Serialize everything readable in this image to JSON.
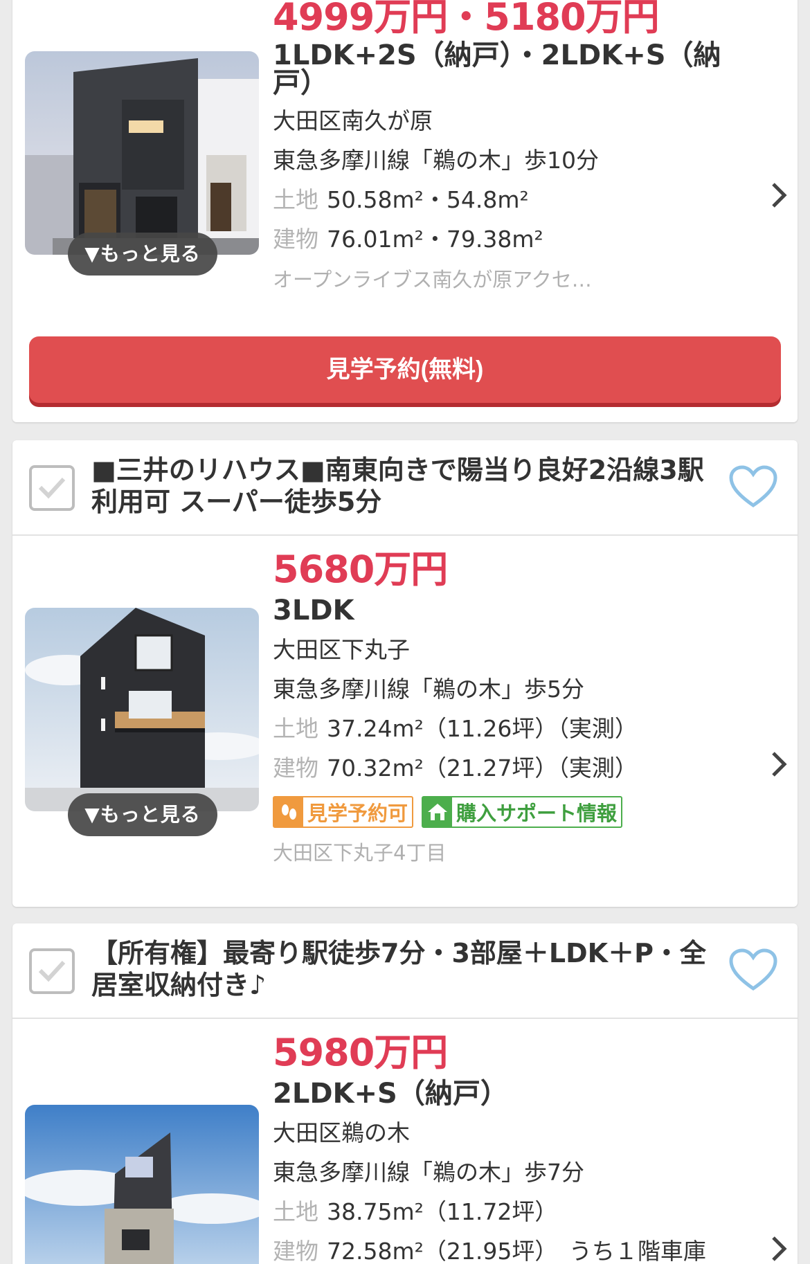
{
  "listings": [
    {
      "price": "4999万円・5180万円",
      "layout": "1LDK+2S（納戸）・2LDK+S（納戸）",
      "address": "大田区南久が原",
      "access": "東急多摩川線「鵜の木」歩10分",
      "land_label": "土地",
      "land_value": "50.58m²・54.8m²",
      "building_label": "建物",
      "building_value": "76.01m²・79.38m²",
      "note": "オープンライブス南久が原アクセ…",
      "more_label": "▼もっと見る",
      "reserve_button": "見学予約(無料)"
    },
    {
      "headline": "■三井のリハウス■南東向きで陽当り良好2沿線3駅利用可 スーパー徒歩5分",
      "price": "5680万円",
      "layout": "3LDK",
      "address": "大田区下丸子",
      "access": "東急多摩川線「鵜の木」歩5分",
      "land_label": "土地",
      "land_value": "37.24m²（11.26坪）（実測）",
      "building_label": "建物",
      "building_value": "70.32m²（21.27坪）（実測）",
      "badge_reserve": "見学予約可",
      "badge_support": "購入サポート情報",
      "note": "大田区下丸子4丁目",
      "more_label": "▼もっと見る"
    },
    {
      "headline": "【所有権】最寄り駅徒歩7分・3部屋＋LDK＋P・全居室収納付き♪",
      "price": "5980万円",
      "layout": "2LDK+S（納戸）",
      "address": "大田区鵜の木",
      "access": "東急多摩川線「鵜の木」歩7分",
      "land_label": "土地",
      "land_value": "38.75m²（11.72坪）",
      "building_label": "建物",
      "building_value": "72.58m²（21.95坪）　うち１階車庫"
    }
  ],
  "colors": {
    "price": "#e03c55",
    "button": "#e04e50",
    "heart": "#8ec2e6",
    "badge_orange": "#f09a3e",
    "badge_green": "#4cae4c"
  },
  "icons": [
    "checkbox-icon",
    "heart-icon",
    "chevron-right-icon",
    "footprint-icon",
    "house-support-icon"
  ]
}
